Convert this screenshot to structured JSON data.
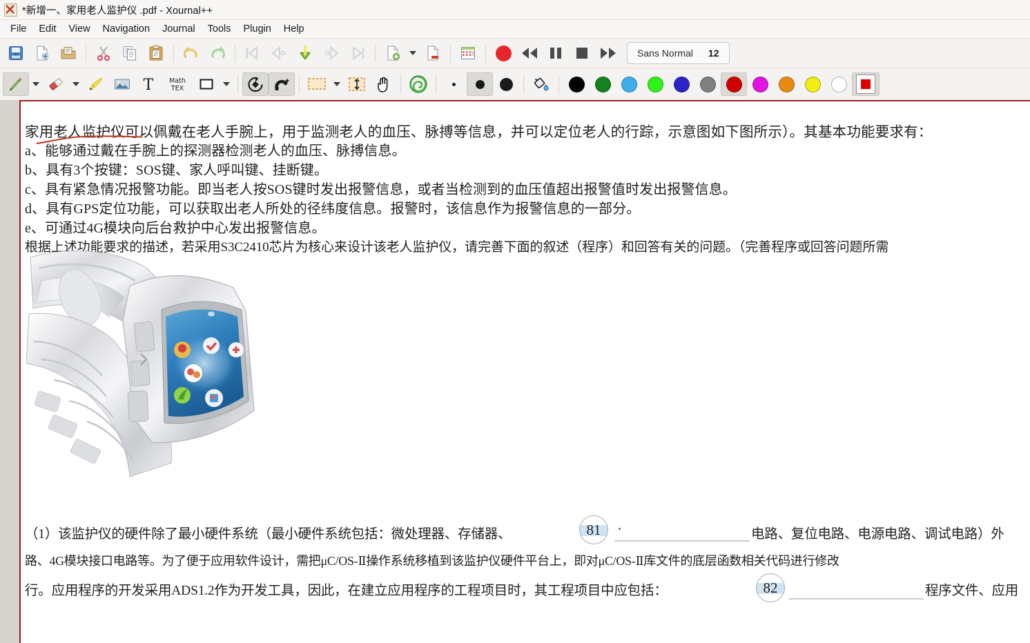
{
  "window": {
    "title": "*新增一、家用老人监护仪 .pdf - Xournal++",
    "app_icon": "xournal-app-icon"
  },
  "menubar": {
    "items": [
      {
        "label": "File"
      },
      {
        "label": "Edit"
      },
      {
        "label": "View"
      },
      {
        "label": "Navigation"
      },
      {
        "label": "Journal"
      },
      {
        "label": "Tools"
      },
      {
        "label": "Plugin"
      },
      {
        "label": "Help"
      }
    ]
  },
  "toolbar_top": {
    "font_name": "Sans Normal",
    "font_size": "12",
    "buttons": [
      {
        "name": "save-button",
        "icon": "save-icon"
      },
      {
        "name": "new-button",
        "icon": "new-document-icon"
      },
      {
        "name": "open-button",
        "icon": "open-folder-icon"
      },
      {
        "name": "cut-button",
        "icon": "scissors-icon"
      },
      {
        "name": "copy-button",
        "icon": "copy-icon"
      },
      {
        "name": "paste-button",
        "icon": "clipboard-paste-icon"
      },
      {
        "name": "undo-button",
        "icon": "undo-arrow-icon"
      },
      {
        "name": "redo-button",
        "icon": "redo-arrow-icon"
      },
      {
        "name": "first-page-button",
        "icon": "skip-to-first-icon"
      },
      {
        "name": "previous-page-button",
        "icon": "previous-page-icon"
      },
      {
        "name": "go-to-page-button",
        "icon": "green-down-arrow-icon"
      },
      {
        "name": "next-page-button",
        "icon": "next-page-icon"
      },
      {
        "name": "last-page-button",
        "icon": "skip-to-last-icon"
      },
      {
        "name": "insert-page-button",
        "icon": "insert-page-icon"
      },
      {
        "name": "insert-page-dropdown",
        "icon": "chevron-down-icon"
      },
      {
        "name": "delete-page-button",
        "icon": "delete-page-icon"
      },
      {
        "name": "page-layout-button",
        "icon": "page-layout-icon"
      },
      {
        "name": "record-button",
        "icon": "record-circle-icon"
      },
      {
        "name": "rewind-button",
        "icon": "rewind-icon"
      },
      {
        "name": "pause-button",
        "icon": "pause-icon"
      },
      {
        "name": "stop-button",
        "icon": "stop-square-icon"
      },
      {
        "name": "forward-button",
        "icon": "fast-forward-icon"
      }
    ]
  },
  "toolbar_tools": {
    "tools": [
      {
        "name": "pen-tool",
        "icon": "pencil-icon",
        "active": true
      },
      {
        "name": "pen-dropdown",
        "icon": "chevron-down-icon"
      },
      {
        "name": "eraser-tool",
        "icon": "eraser-icon"
      },
      {
        "name": "eraser-dropdown",
        "icon": "chevron-down-icon"
      },
      {
        "name": "highlighter-tool",
        "icon": "highlighter-icon"
      },
      {
        "name": "image-tool",
        "icon": "image-icon"
      },
      {
        "name": "text-tool",
        "icon": "text-t-icon"
      },
      {
        "name": "latex-tool",
        "icon": "math-tex-icon",
        "label": "Math TEX"
      },
      {
        "name": "shape-tool",
        "icon": "square-shape-icon"
      },
      {
        "name": "shape-dropdown",
        "icon": "chevron-down-icon"
      },
      {
        "name": "shape-recognizer-tool",
        "icon": "shape-recognizer-icon"
      },
      {
        "name": "snap-magnet-tool",
        "icon": "magnet-icon"
      },
      {
        "name": "select-rectangle-tool",
        "icon": "dashed-rectangle-icon"
      },
      {
        "name": "select-dropdown",
        "icon": "chevron-down-icon"
      },
      {
        "name": "vertical-space-tool",
        "icon": "vertical-space-icon"
      },
      {
        "name": "hand-tool",
        "icon": "hand-icon"
      },
      {
        "name": "spiral-tool",
        "icon": "green-spiral-icon"
      },
      {
        "name": "thin-width-button",
        "icon": "thin-dot-icon"
      },
      {
        "name": "medium-width-button",
        "icon": "medium-dot-icon",
        "active": true
      },
      {
        "name": "thick-width-button",
        "icon": "thick-dot-icon"
      },
      {
        "name": "fill-tool",
        "icon": "paint-bucket-icon"
      }
    ],
    "colors": [
      {
        "name": "color-black",
        "hex": "#000000"
      },
      {
        "name": "color-dark-green",
        "hex": "#15821e"
      },
      {
        "name": "color-light-blue",
        "hex": "#3daee9"
      },
      {
        "name": "color-green",
        "hex": "#2ff318"
      },
      {
        "name": "color-blue",
        "hex": "#2a24c8"
      },
      {
        "name": "color-gray",
        "hex": "#808080"
      },
      {
        "name": "color-red",
        "hex": "#d00000",
        "selected": true
      },
      {
        "name": "color-magenta",
        "hex": "#e214e2"
      },
      {
        "name": "color-orange",
        "hex": "#e88c11"
      },
      {
        "name": "color-yellow",
        "hex": "#f2ed15"
      },
      {
        "name": "color-white",
        "hex": "#ffffff"
      }
    ],
    "color_picker": {
      "name": "color-picker",
      "hex": "#e00000",
      "selected": true
    }
  },
  "document": {
    "page_border_color": "#a01b24",
    "ink_annotation": {
      "name": "red-underline-stroke",
      "color": "#c0392b"
    },
    "image": {
      "name": "smartwatch-photo",
      "alt": "silver metal band smartwatch with blue app screen"
    },
    "lines": {
      "intro": "家用老人监护仪可以佩戴在老人手腕上，用于监测老人的血压、脉搏等信息，并可以定位老人的行踪，示意图如下图所示）。其基本功能要求有：",
      "a": "a、能够通过戴在手腕上的探测器检测老人的血压、脉搏信息。",
      "b": "b、具有3个按键：SOS键、家人呼叫键、挂断键。",
      "c": "c、具有紧急情况报警功能。即当老人按SOS键时发出报警信息，或者当检测到的血压值超出报警值时发出报警信息。",
      "d": "d、具有GPS定位功能，可以获取出老人所处的径纬度信息。报警时，该信息作为报警信息的一部分。",
      "e": "e、可通过4G模块向后台救护中心发出报警信息。",
      "requirement": "根据上述功能要求的描述，若采用S3C2410芯片为核心来设计该老人监护仪，请完善下面的叙述（程序）和回答有关的问题。（完善程序或回答问题所需",
      "q1_before": "（1）该监护仪的硬件除了最小硬件系统（最小硬件系统包括：微处理器、存储器、",
      "q1_after": "电路、复位电路、电源电路、调试电路）外",
      "q1_line2": "路、4G模块接口电路等。为了便于应用软件设计，需把μC/OS-Ⅱ操作系统移植到该监护仪硬件平台上，即对μC/OS-Ⅱ库文件的底层函数相关代码进行修改",
      "q1_line3_before": "行。应用程序的开发采用ADS1.2作为开发工具，因此，在建立应用程序的工程项目时，其工程项目中应包括：",
      "q1_line3_after": "程序文件、应用"
    },
    "blanks": [
      {
        "name": "blank-81",
        "number": "81"
      },
      {
        "name": "blank-82",
        "number": "82"
      }
    ]
  }
}
